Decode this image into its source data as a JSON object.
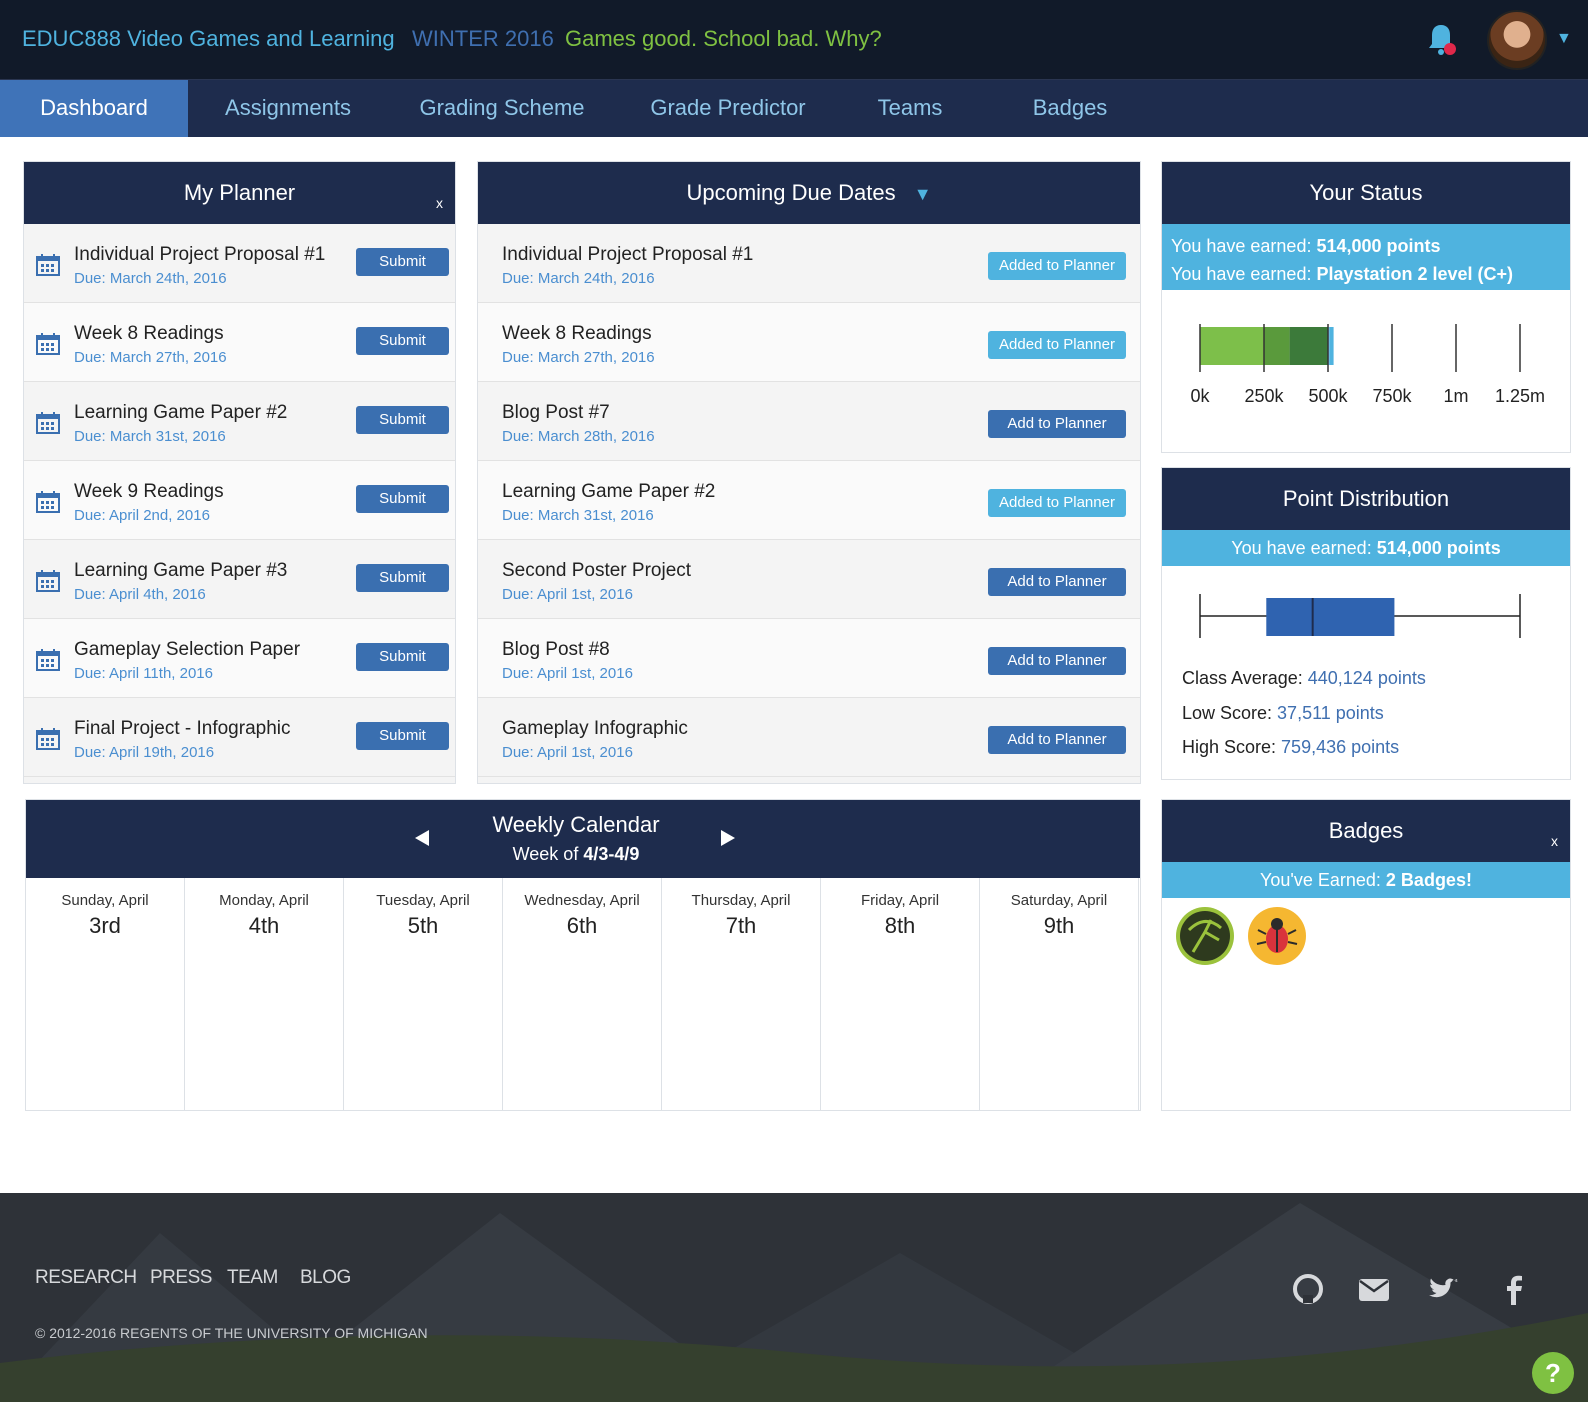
{
  "header": {
    "course": "EDUC888 Video Games and Learning",
    "term": "WINTER 2016",
    "tagline": "Games good. School bad. Why?"
  },
  "nav": {
    "tabs": [
      "Dashboard",
      "Assignments",
      "Grading Scheme",
      "Grade Predictor",
      "Teams",
      "Badges"
    ]
  },
  "planner": {
    "title": "My Planner",
    "close": "x",
    "items": [
      {
        "title": "Individual Project Proposal #1",
        "due": "Due: March 24th, 2016",
        "action": "Submit"
      },
      {
        "title": "Week 8 Readings",
        "due": "Due: March 27th, 2016",
        "action": "Submit"
      },
      {
        "title": "Learning Game Paper #2",
        "due": "Due: March 31st, 2016",
        "action": "Submit"
      },
      {
        "title": "Week 9 Readings",
        "due": "Due: April 2nd, 2016",
        "action": "Submit"
      },
      {
        "title": "Learning Game Paper #3",
        "due": "Due: April 4th, 2016",
        "action": "Submit"
      },
      {
        "title": "Gameplay Selection Paper",
        "due": "Due: April 11th, 2016",
        "action": "Submit"
      },
      {
        "title": "Final Project - Infographic",
        "due": "Due: April 19th, 2016",
        "action": "Submit"
      }
    ]
  },
  "upcoming": {
    "title": "Upcoming Due Dates",
    "caret": "▼",
    "items": [
      {
        "title": "Individual Project Proposal #1",
        "due": "Due: March 24th, 2016",
        "action": "Added to Planner",
        "added": true
      },
      {
        "title": "Week 8 Readings",
        "due": "Due: March 27th, 2016",
        "action": "Added to Planner",
        "added": true
      },
      {
        "title": "Blog Post #7",
        "due": "Due: March 28th, 2016",
        "action": "Add to Planner",
        "added": false
      },
      {
        "title": "Learning Game Paper #2",
        "due": "Due: March 31st, 2016",
        "action": "Added to Planner",
        "added": true
      },
      {
        "title": "Second Poster Project",
        "due": "Due: April 1st, 2016",
        "action": "Add to Planner",
        "added": false
      },
      {
        "title": "Blog Post #8",
        "due": "Due: April 1st, 2016",
        "action": "Add to Planner",
        "added": false
      },
      {
        "title": "Gameplay Infographic",
        "due": "Due: April 1st, 2016",
        "action": "Add to Planner",
        "added": false
      }
    ]
  },
  "status": {
    "title": "Your Status",
    "line1_label": "You have earned: ",
    "line1_value": "514,000 points",
    "line2_label": "You have earned: ",
    "line2_value": "Playstation 2 level (C+)",
    "earned_points": 514000,
    "axis_max": 1250000,
    "axis_labels": [
      "0k",
      "250k",
      "500k",
      "750k",
      "1m",
      "1.25m"
    ]
  },
  "distribution": {
    "title": "Point Distribution",
    "banner_label": "You have earned: ",
    "banner_value": "514,000 points",
    "class_avg_label": "Class Average: ",
    "class_avg_value": "440,124 points",
    "low_label": "Low Score: ",
    "low_value": "37,511 points",
    "high_label": "High Score: ",
    "high_value": "759,436 points",
    "low": 37511,
    "average": 440124,
    "high": 759436
  },
  "calendar": {
    "title": "Weekly Calendar",
    "week_prefix": "Week of ",
    "week_value": "4/3-4/9",
    "days": [
      {
        "name": "Sunday, April",
        "num": "3rd"
      },
      {
        "name": "Monday, April",
        "num": "4th"
      },
      {
        "name": "Tuesday, April",
        "num": "5th"
      },
      {
        "name": "Wednesday, April",
        "num": "6th"
      },
      {
        "name": "Thursday, April",
        "num": "7th"
      },
      {
        "name": "Friday, April",
        "num": "8th"
      },
      {
        "name": "Saturday, April",
        "num": "9th"
      }
    ]
  },
  "badges": {
    "title": "Badges",
    "close": "x",
    "banner_label": "You've Earned: ",
    "banner_value": "2 Badges!",
    "items": [
      "archer-badge-icon",
      "bug-badge-icon"
    ]
  },
  "footer": {
    "links": [
      "RESEARCH",
      "PRESS",
      "TEAM",
      "BLOG"
    ],
    "copyright": "© 2012-2016 REGENTS OF THE UNIVERSITY OF MICHIGAN",
    "social": [
      "github-icon",
      "mail-icon",
      "twitter-icon",
      "facebook-icon"
    ],
    "help": "?"
  },
  "colors": {
    "header_bg": "#111a29",
    "nav_bg": "#1e2c4d",
    "accent_blue": "#4fb3df",
    "button_blue": "#3a6fb0",
    "green": "#7fc142"
  }
}
